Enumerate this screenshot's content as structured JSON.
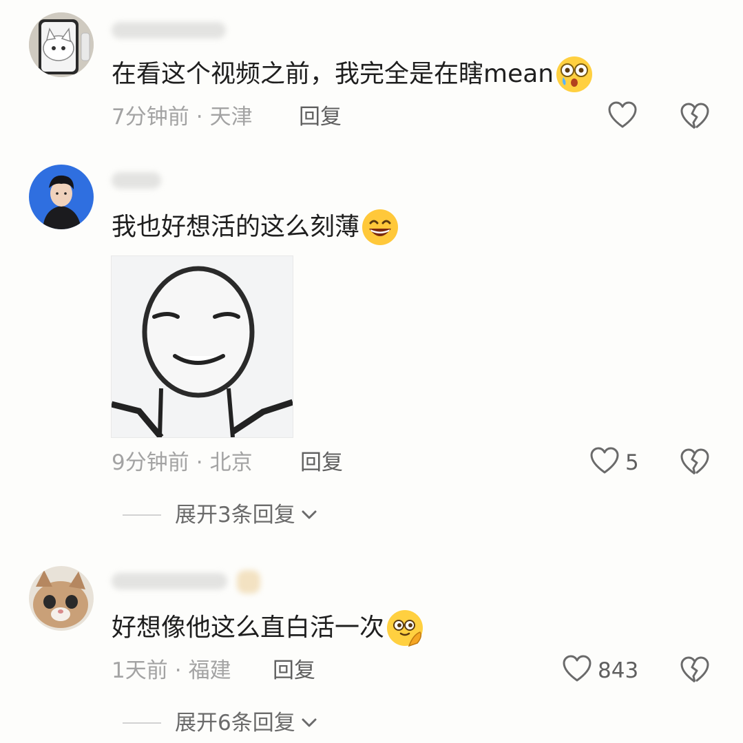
{
  "comments": [
    {
      "text": "在看这个视频之前，我完全是在瞎mean",
      "emoji": "shocked-crying-emoji",
      "time": "7分钟前",
      "location": "天津",
      "reply_label": "回复",
      "likes": ""
    },
    {
      "text": "我也好想活的这么刻薄",
      "emoji": "grinning-emoji",
      "time": "9分钟前",
      "location": "北京",
      "reply_label": "回复",
      "likes": "5",
      "expand_label": "展开3条回复"
    },
    {
      "text": "好想像他这么直白活一次",
      "emoji": "thinking-hand-on-chin-emoji",
      "time": "1天前",
      "location": "福建",
      "reply_label": "回复",
      "likes": "843",
      "expand_label": "展开6条回复"
    }
  ],
  "separator": "·",
  "colors": {
    "background": "#fdfdfb",
    "text": "#1e1e1e",
    "meta": "#a3a3a3",
    "action": "#5f5f5f"
  }
}
